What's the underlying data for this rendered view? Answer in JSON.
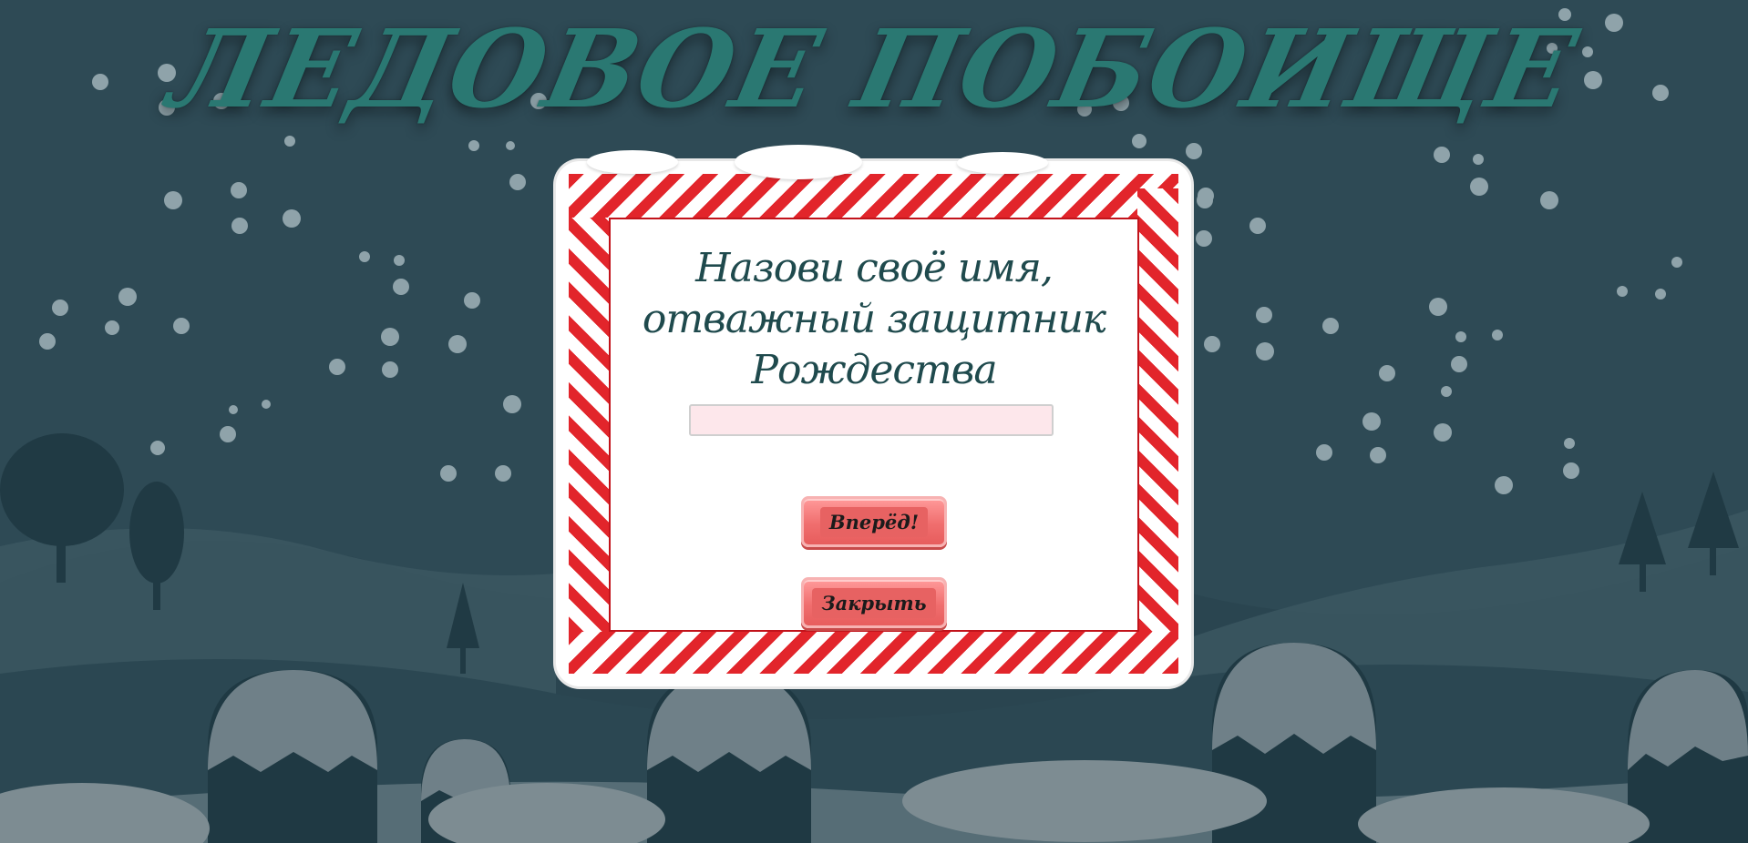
{
  "game": {
    "title": "ЛЕДОВОЕ ПОБОИЩЕ"
  },
  "dialog": {
    "prompt_lines": [
      "Назови своё имя,",
      "отважный защитник",
      "Рождества"
    ],
    "name_input": {
      "value": "",
      "placeholder": ""
    },
    "go_button_label": "Вперёд!",
    "close_button_label": "Закрыть"
  },
  "colors": {
    "background": "#2e4a55",
    "title": "#2a7872",
    "stripe_red": "#e2252b",
    "prompt_text": "#1f4a4d",
    "button": "#f06e6e",
    "input_bg": "#fde7eb"
  }
}
